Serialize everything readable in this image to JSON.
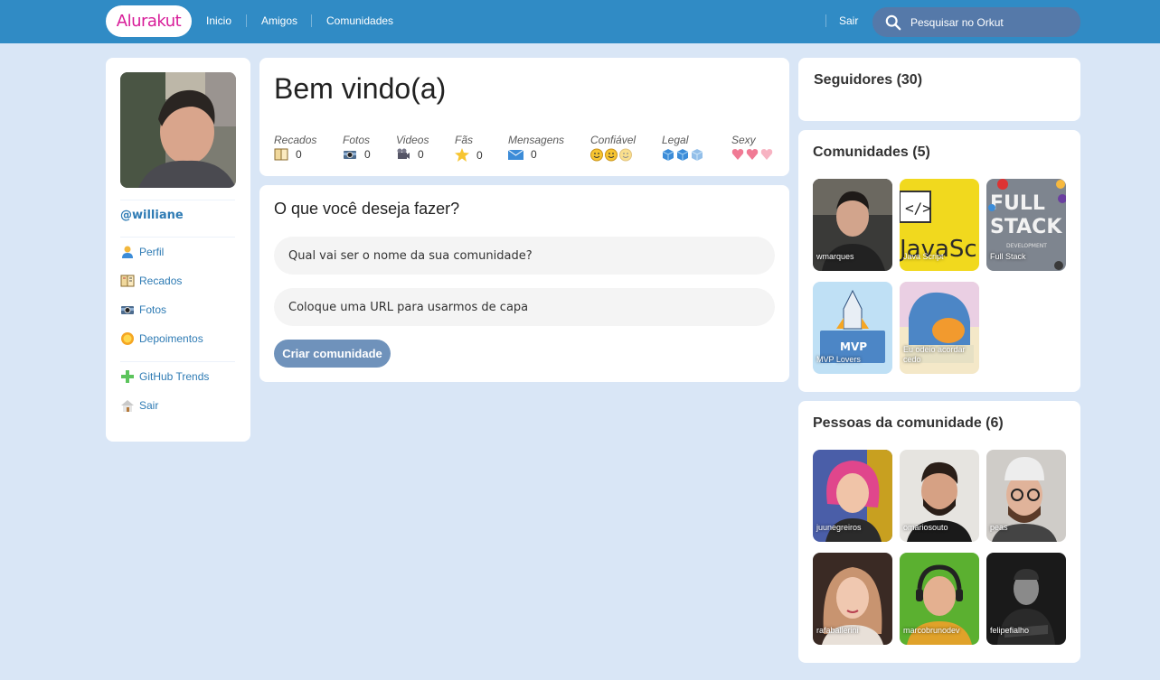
{
  "header": {
    "logo": "Alurakut",
    "nav": [
      "Inicio",
      "Amigos",
      "Comunidades"
    ],
    "logout": "Sair",
    "search_placeholder": "Pesquisar no Orkut"
  },
  "sidebar": {
    "username": "@williane",
    "menu": [
      {
        "label": "Perfil",
        "icon": "user-icon"
      },
      {
        "label": "Recados",
        "icon": "book-icon"
      },
      {
        "label": "Fotos",
        "icon": "camera-icon"
      },
      {
        "label": "Depoimentos",
        "icon": "sun-icon"
      },
      {
        "label": "GitHub Trends",
        "icon": "plus-icon"
      },
      {
        "label": "Sair",
        "icon": "logout-icon"
      }
    ]
  },
  "welcome": {
    "title": "Bem vindo(a)",
    "stats": [
      {
        "label": "Recados",
        "value": "0",
        "icon": "book-icon"
      },
      {
        "label": "Fotos",
        "value": "0",
        "icon": "camera-icon"
      },
      {
        "label": "Videos",
        "value": "0",
        "icon": "video-camera-icon"
      },
      {
        "label": "Fãs",
        "value": "0",
        "icon": "star-icon"
      },
      {
        "label": "Mensagens",
        "value": "0",
        "icon": "envelope-icon"
      },
      {
        "label": "Confiável",
        "icon": "smiley-icon"
      },
      {
        "label": "Legal",
        "icon": "ice-cube-icon"
      },
      {
        "label": "Sexy",
        "icon": "heart-icon"
      }
    ]
  },
  "form": {
    "title": "O que você deseja fazer?",
    "name_placeholder": "Qual vai ser o nome da sua comunidade?",
    "url_placeholder": "Coloque uma URL para usarmos de capa",
    "submit_label": "Criar comunidade"
  },
  "followers": {
    "title": "Seguidores (30)"
  },
  "communities": {
    "title": "Comunidades (5)",
    "items": [
      "wmarques",
      "Java Script",
      "Full Stack",
      "MVP Lovers",
      "Eu odeio acordar cedo"
    ]
  },
  "people": {
    "title": "Pessoas da comunidade (6)",
    "items": [
      "juunegreiros",
      "omariosouto",
      "peas",
      "rafaballerini",
      "marcobrunodev",
      "felipefialho"
    ]
  },
  "colors": {
    "header_bg": "#308BC5",
    "page_bg": "#D9E6F6",
    "link": "#2E7BB4",
    "logo": "#D81D99",
    "button": "#6F92BB"
  }
}
